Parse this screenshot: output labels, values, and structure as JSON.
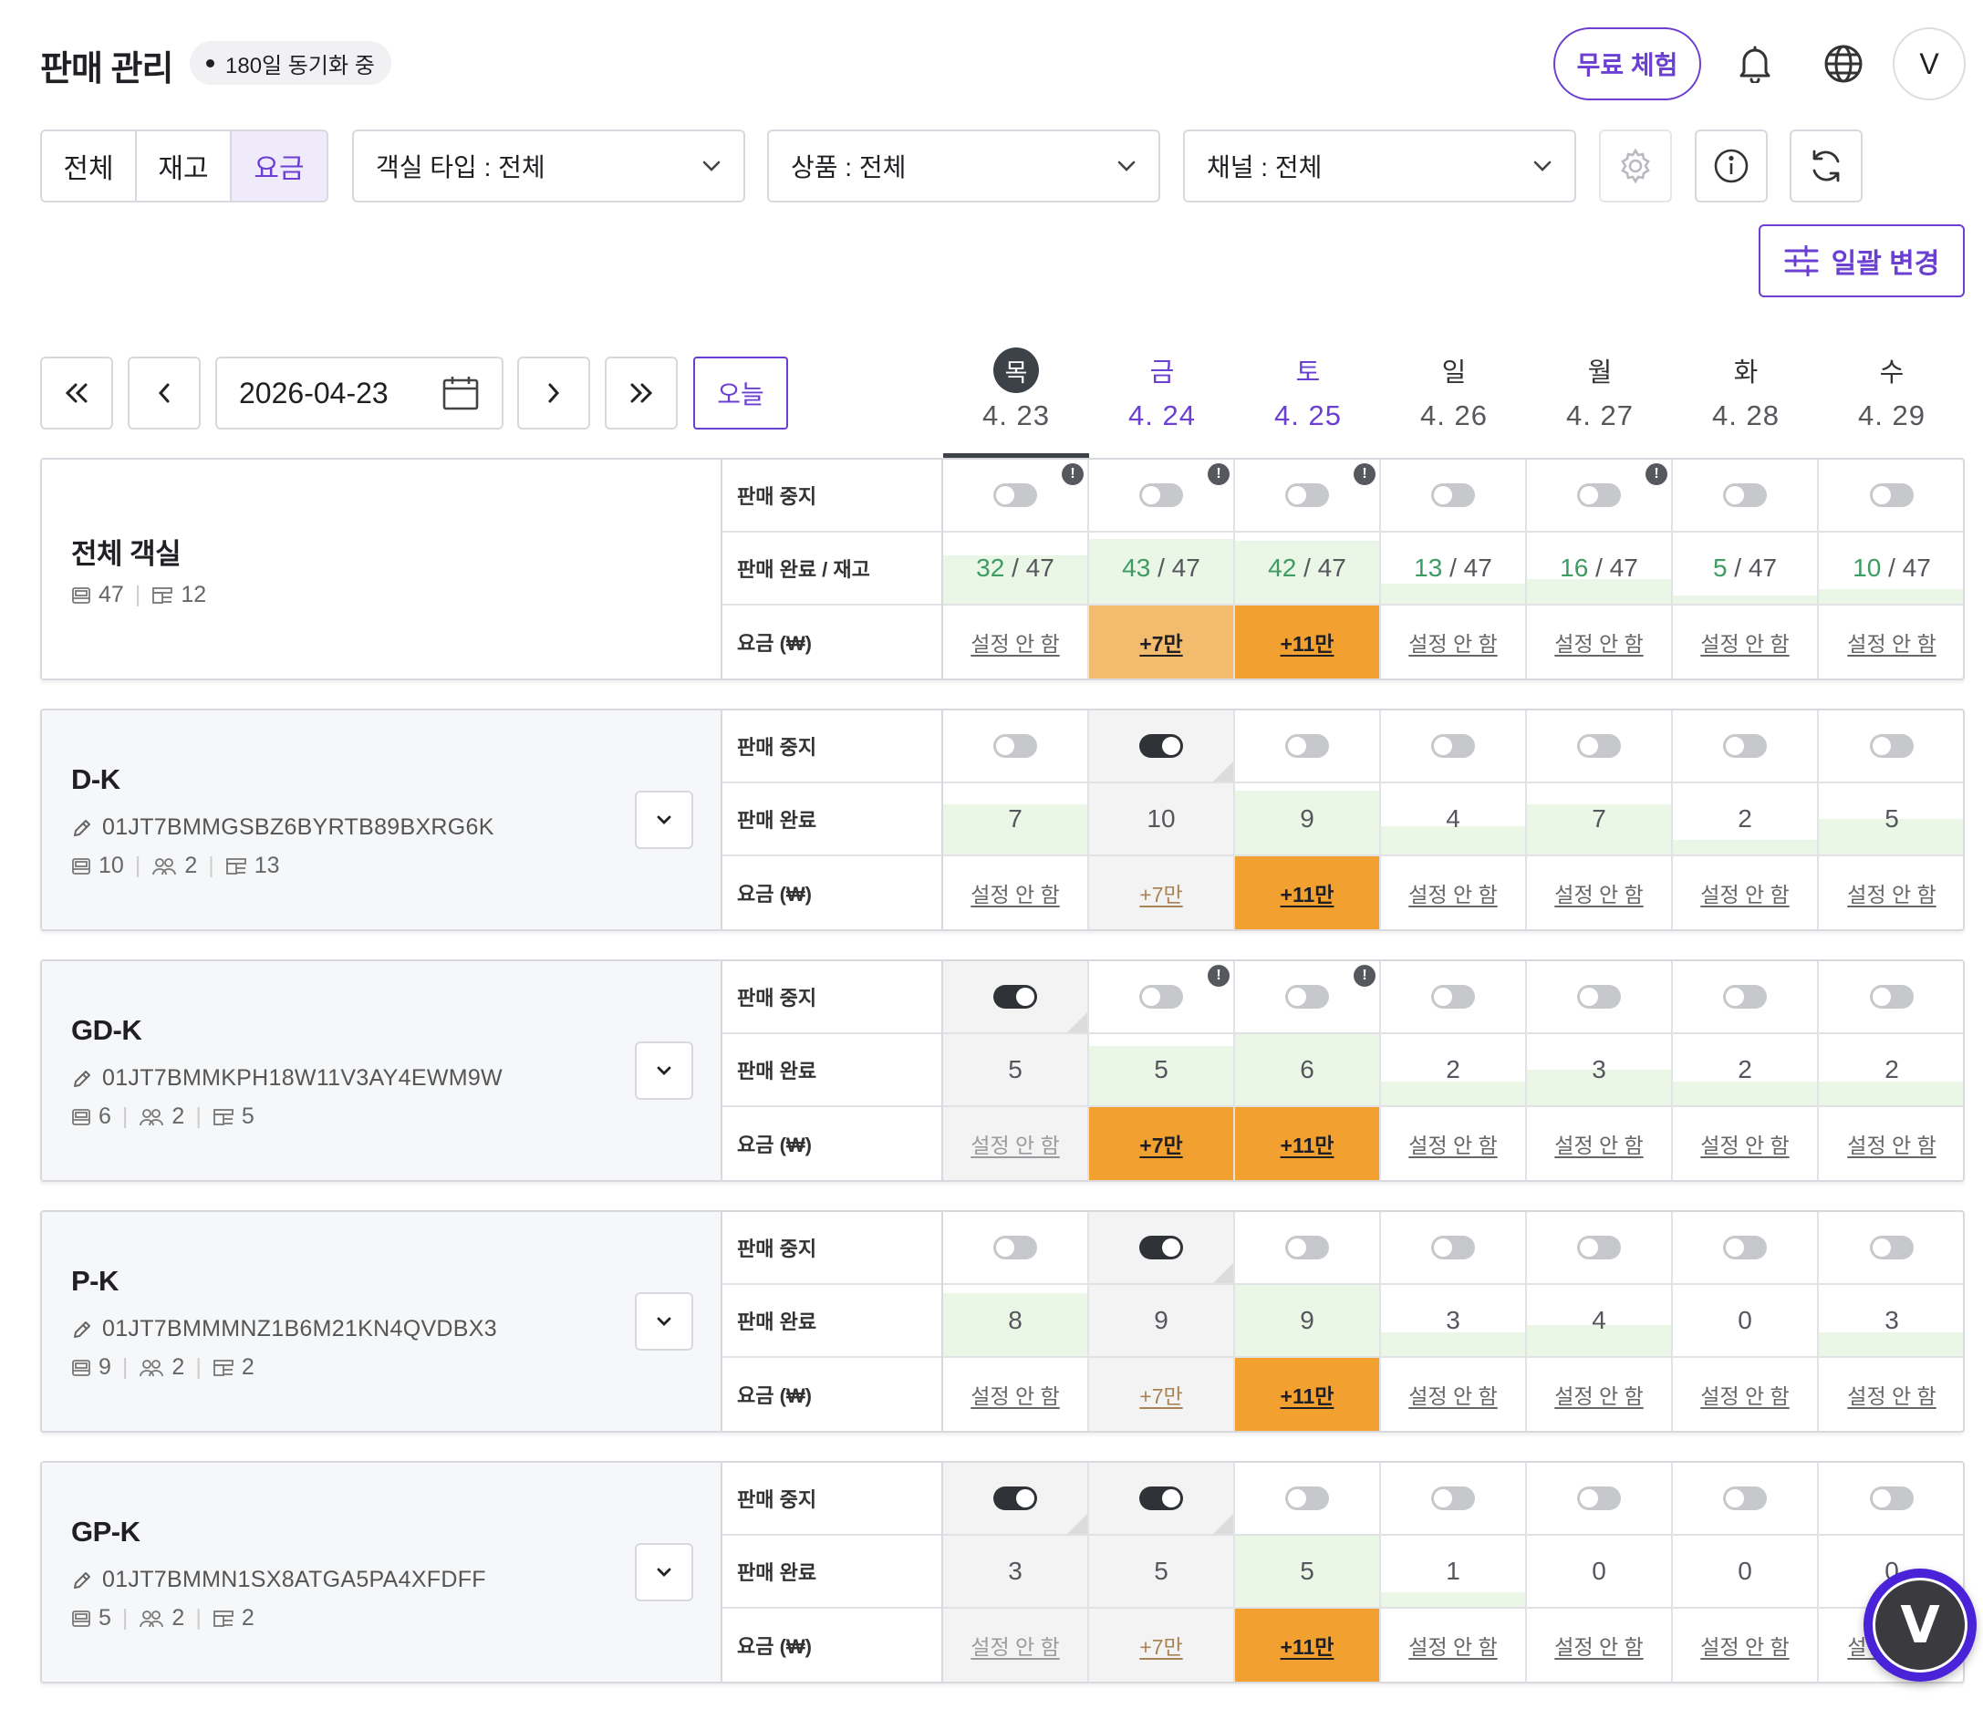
{
  "header": {
    "title": "판매 관리",
    "sync_badge": "180일 동기화 중",
    "trial_label": "무료 체험",
    "avatar_initial": "V"
  },
  "filters": {
    "segments": [
      {
        "label": "전체",
        "active": false
      },
      {
        "label": "재고",
        "active": false
      },
      {
        "label": "요금",
        "active": true
      }
    ],
    "room_type": "객실 타입 : 전체",
    "product": "상품 : 전체",
    "channel": "채널 : 전체",
    "bulk_change_label": "일괄 변경"
  },
  "date_nav": {
    "current_date": "2026-04-23",
    "today_label": "오늘"
  },
  "days": [
    {
      "dow": "목",
      "date": "4. 23",
      "selected": true,
      "purple": false
    },
    {
      "dow": "금",
      "date": "4. 24",
      "selected": false,
      "purple": true
    },
    {
      "dow": "토",
      "date": "4. 25",
      "selected": false,
      "purple": true
    },
    {
      "dow": "일",
      "date": "4. 26",
      "selected": false,
      "purple": false
    },
    {
      "dow": "월",
      "date": "4. 27",
      "selected": false,
      "purple": false
    },
    {
      "dow": "화",
      "date": "4. 28",
      "selected": false,
      "purple": false
    },
    {
      "dow": "수",
      "date": "4. 29",
      "selected": false,
      "purple": false
    }
  ],
  "labels": {
    "stop_sale": "판매 중지",
    "sold_stock": "판매 완료 / 재고",
    "sold": "판매 완료",
    "price": "요금 (₩)"
  },
  "total": {
    "name": "전체 객실",
    "rooms": "47",
    "listings": "12",
    "cells": [
      {
        "stopped": false,
        "toggle": false,
        "warn": true,
        "sold": "32",
        "stock": "47",
        "fill": 0.68,
        "price": "설정 안 함",
        "ptype": "none"
      },
      {
        "stopped": false,
        "toggle": false,
        "warn": true,
        "sold": "43",
        "stock": "47",
        "fill": 0.91,
        "price": "+7만",
        "ptype": "light"
      },
      {
        "stopped": false,
        "toggle": false,
        "warn": true,
        "sold": "42",
        "stock": "47",
        "fill": 0.89,
        "price": "+11만",
        "ptype": "strong"
      },
      {
        "stopped": false,
        "toggle": false,
        "warn": false,
        "sold": "13",
        "stock": "47",
        "fill": 0.28,
        "price": "설정 안 함",
        "ptype": "none"
      },
      {
        "stopped": false,
        "toggle": false,
        "warn": true,
        "sold": "16",
        "stock": "47",
        "fill": 0.34,
        "price": "설정 안 함",
        "ptype": "none"
      },
      {
        "stopped": false,
        "toggle": false,
        "warn": false,
        "sold": "5",
        "stock": "47",
        "fill": 0.11,
        "price": "설정 안 함",
        "ptype": "none"
      },
      {
        "stopped": false,
        "toggle": false,
        "warn": false,
        "sold": "10",
        "stock": "47",
        "fill": 0.21,
        "price": "설정 안 함",
        "ptype": "none"
      }
    ]
  },
  "rooms": [
    {
      "name": "D-K",
      "code": "01JT7BMMGSBZ6BYRTB89BXRG6K",
      "rooms": "10",
      "guests": "2",
      "listings": "13",
      "cells": [
        {
          "stopped": false,
          "toggle": false,
          "warn": false,
          "sold": "7",
          "fill": 0.7,
          "price": "설정 안 함",
          "ptype": "none"
        },
        {
          "stopped": true,
          "toggle": true,
          "warn": false,
          "sold": "10",
          "fill": 1.0,
          "price": "+7만",
          "ptype": "muted"
        },
        {
          "stopped": false,
          "toggle": false,
          "warn": false,
          "sold": "9",
          "fill": 0.9,
          "price": "+11만",
          "ptype": "strong"
        },
        {
          "stopped": false,
          "toggle": false,
          "warn": false,
          "sold": "4",
          "fill": 0.4,
          "price": "설정 안 함",
          "ptype": "none"
        },
        {
          "stopped": false,
          "toggle": false,
          "warn": false,
          "sold": "7",
          "fill": 0.7,
          "price": "설정 안 함",
          "ptype": "none"
        },
        {
          "stopped": false,
          "toggle": false,
          "warn": false,
          "sold": "2",
          "fill": 0.2,
          "price": "설정 안 함",
          "ptype": "none"
        },
        {
          "stopped": false,
          "toggle": false,
          "warn": false,
          "sold": "5",
          "fill": 0.5,
          "price": "설정 안 함",
          "ptype": "none"
        }
      ]
    },
    {
      "name": "GD-K",
      "code": "01JT7BMMKPH18W11V3AY4EWM9W",
      "rooms": "6",
      "guests": "2",
      "listings": "5",
      "cells": [
        {
          "stopped": true,
          "toggle": true,
          "warn": false,
          "sold": "5",
          "fill": 0.83,
          "price": "설정 안 함",
          "ptype": "none"
        },
        {
          "stopped": false,
          "toggle": false,
          "warn": true,
          "sold": "5",
          "fill": 0.83,
          "price": "+7만",
          "ptype": "strong"
        },
        {
          "stopped": false,
          "toggle": false,
          "warn": true,
          "sold": "6",
          "fill": 1.0,
          "price": "+11만",
          "ptype": "strong"
        },
        {
          "stopped": false,
          "toggle": false,
          "warn": false,
          "sold": "2",
          "fill": 0.33,
          "price": "설정 안 함",
          "ptype": "none"
        },
        {
          "stopped": false,
          "toggle": false,
          "warn": false,
          "sold": "3",
          "fill": 0.5,
          "price": "설정 안 함",
          "ptype": "none"
        },
        {
          "stopped": false,
          "toggle": false,
          "warn": false,
          "sold": "2",
          "fill": 0.33,
          "price": "설정 안 함",
          "ptype": "none"
        },
        {
          "stopped": false,
          "toggle": false,
          "warn": false,
          "sold": "2",
          "fill": 0.33,
          "price": "설정 안 함",
          "ptype": "none"
        }
      ]
    },
    {
      "name": "P-K",
      "code": "01JT7BMMMNZ1B6M21KN4QVDBX3",
      "rooms": "9",
      "guests": "2",
      "listings": "2",
      "cells": [
        {
          "stopped": false,
          "toggle": false,
          "warn": false,
          "sold": "8",
          "fill": 0.89,
          "price": "설정 안 함",
          "ptype": "none"
        },
        {
          "stopped": true,
          "toggle": true,
          "warn": false,
          "sold": "9",
          "fill": 1.0,
          "price": "+7만",
          "ptype": "muted"
        },
        {
          "stopped": false,
          "toggle": false,
          "warn": false,
          "sold": "9",
          "fill": 1.0,
          "price": "+11만",
          "ptype": "strong"
        },
        {
          "stopped": false,
          "toggle": false,
          "warn": false,
          "sold": "3",
          "fill": 0.33,
          "price": "설정 안 함",
          "ptype": "none"
        },
        {
          "stopped": false,
          "toggle": false,
          "warn": false,
          "sold": "4",
          "fill": 0.44,
          "price": "설정 안 함",
          "ptype": "none"
        },
        {
          "stopped": false,
          "toggle": false,
          "warn": false,
          "sold": "0",
          "fill": 0.0,
          "price": "설정 안 함",
          "ptype": "none"
        },
        {
          "stopped": false,
          "toggle": false,
          "warn": false,
          "sold": "3",
          "fill": 0.33,
          "price": "설정 안 함",
          "ptype": "none"
        }
      ]
    },
    {
      "name": "GP-K",
      "code": "01JT7BMMN1SX8ATGA5PA4XFDFF",
      "rooms": "5",
      "guests": "2",
      "listings": "2",
      "cells": [
        {
          "stopped": true,
          "toggle": true,
          "warn": false,
          "sold": "3",
          "fill": 0.6,
          "price": "설정 안 함",
          "ptype": "none"
        },
        {
          "stopped": true,
          "toggle": true,
          "warn": false,
          "sold": "5",
          "fill": 1.0,
          "price": "+7만",
          "ptype": "muted"
        },
        {
          "stopped": false,
          "toggle": false,
          "warn": false,
          "sold": "5",
          "fill": 1.0,
          "price": "+11만",
          "ptype": "strong"
        },
        {
          "stopped": false,
          "toggle": false,
          "warn": false,
          "sold": "1",
          "fill": 0.2,
          "price": "설정 안 함",
          "ptype": "none"
        },
        {
          "stopped": false,
          "toggle": false,
          "warn": false,
          "sold": "0",
          "fill": 0.0,
          "price": "설정 안 함",
          "ptype": "none"
        },
        {
          "stopped": false,
          "toggle": false,
          "warn": false,
          "sold": "0",
          "fill": 0.0,
          "price": "설정 안 함",
          "ptype": "none"
        },
        {
          "stopped": false,
          "toggle": false,
          "warn": false,
          "sold": "0",
          "fill": 0.0,
          "price": "설정 안 함",
          "ptype": "none"
        }
      ]
    }
  ],
  "icons": {
    "bell": "bell-icon",
    "globe": "globe-icon",
    "settings": "gear-icon",
    "info": "info-icon",
    "refresh": "refresh-icon",
    "calendar": "calendar-icon",
    "pencil": "pencil-icon",
    "bed": "bed-icon",
    "people": "people-icon",
    "listing": "listing-icon",
    "chevron": "chevron-down-icon"
  },
  "colors": {
    "accent": "#6b3fd1",
    "sold_fill": "#eaf7e6",
    "price_light": "#f3bb6e",
    "price_muted": "#f1c994",
    "price_strong": "#f2a02f",
    "sold_text": "#3d9c62"
  }
}
